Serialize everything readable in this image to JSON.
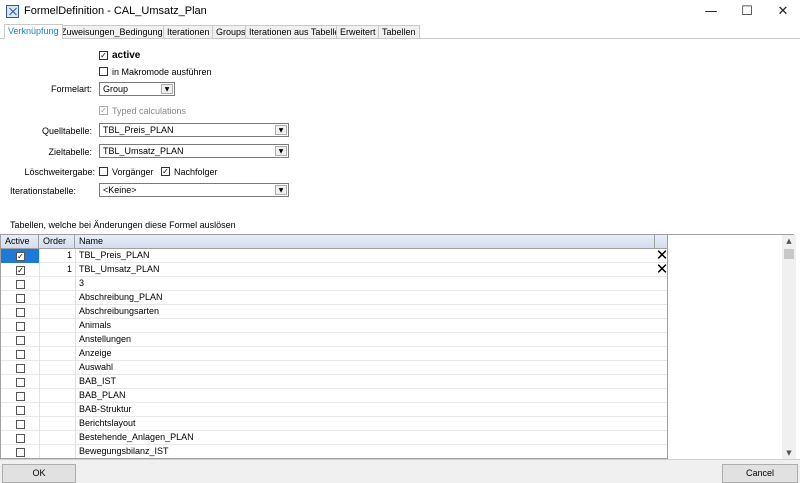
{
  "window": {
    "title": "FormelDefinition - CAL_Umsatz_Plan",
    "minimize": "—",
    "maximize": "☐",
    "close": "✕"
  },
  "tabs": [
    {
      "label": "Verknüpfung",
      "active": true
    },
    {
      "label": "Zuweisungen_Bedingungen"
    },
    {
      "label": "Iterationen"
    },
    {
      "label": "Groups"
    },
    {
      "label": "Iterationen aus Tabelle"
    },
    {
      "label": "Erweitert"
    },
    {
      "label": "Tabellen"
    }
  ],
  "form": {
    "active_label": "active",
    "active_checked": true,
    "makromode_label": "in Makromode ausführen",
    "makromode_checked": false,
    "formelart_label": "Formelart:",
    "formelart_value": "Group",
    "typed_label": "Typed calculations",
    "typed_checked": true,
    "quelltabelle_label": "Quelltabelle:",
    "quelltabelle_value": "TBL_Preis_PLAN",
    "zieltabelle_label": "Zieltabelle:",
    "zieltabelle_value": "TBL_Umsatz_PLAN",
    "loeschweitergabe_label": "Löschweitergabe:",
    "vorgaenger_label": "Vorgänger",
    "vorgaenger_checked": false,
    "nachfolger_label": "Nachfolger",
    "nachfolger_checked": true,
    "iterationstabelle_label": "Iterationstabelle:",
    "iterationstabelle_value": "<Keine>"
  },
  "section_label": "Tabellen, welche bei Änderungen diese Formel auslösen",
  "grid": {
    "headers": {
      "active": "Active",
      "order": "Order",
      "name": "Name"
    },
    "rows": [
      {
        "active": true,
        "order": "1",
        "name": "TBL_Preis_PLAN",
        "deletable": true,
        "selected": true
      },
      {
        "active": true,
        "order": "1",
        "name": "TBL_Umsatz_PLAN",
        "deletable": true
      },
      {
        "active": false,
        "order": "",
        "name": "3"
      },
      {
        "active": false,
        "order": "",
        "name": "Abschreibung_PLAN"
      },
      {
        "active": false,
        "order": "",
        "name": "Abschreibungsarten"
      },
      {
        "active": false,
        "order": "",
        "name": "Animals"
      },
      {
        "active": false,
        "order": "",
        "name": "Anstellungen"
      },
      {
        "active": false,
        "order": "",
        "name": "Anzeige"
      },
      {
        "active": false,
        "order": "",
        "name": "Auswahl"
      },
      {
        "active": false,
        "order": "",
        "name": "BAB_IST"
      },
      {
        "active": false,
        "order": "",
        "name": "BAB_PLAN"
      },
      {
        "active": false,
        "order": "",
        "name": "BAB-Struktur"
      },
      {
        "active": false,
        "order": "",
        "name": "Berichtslayout"
      },
      {
        "active": false,
        "order": "",
        "name": "Bestehende_Anlagen_PLAN"
      },
      {
        "active": false,
        "order": "",
        "name": "Bewegungsbilanz_IST"
      }
    ],
    "delete_glyph": "✕",
    "check_glyph": "✓"
  },
  "scroll": {
    "up": "▲",
    "down": "▼"
  },
  "footer": {
    "ok": "OK",
    "cancel": "Cancel"
  }
}
